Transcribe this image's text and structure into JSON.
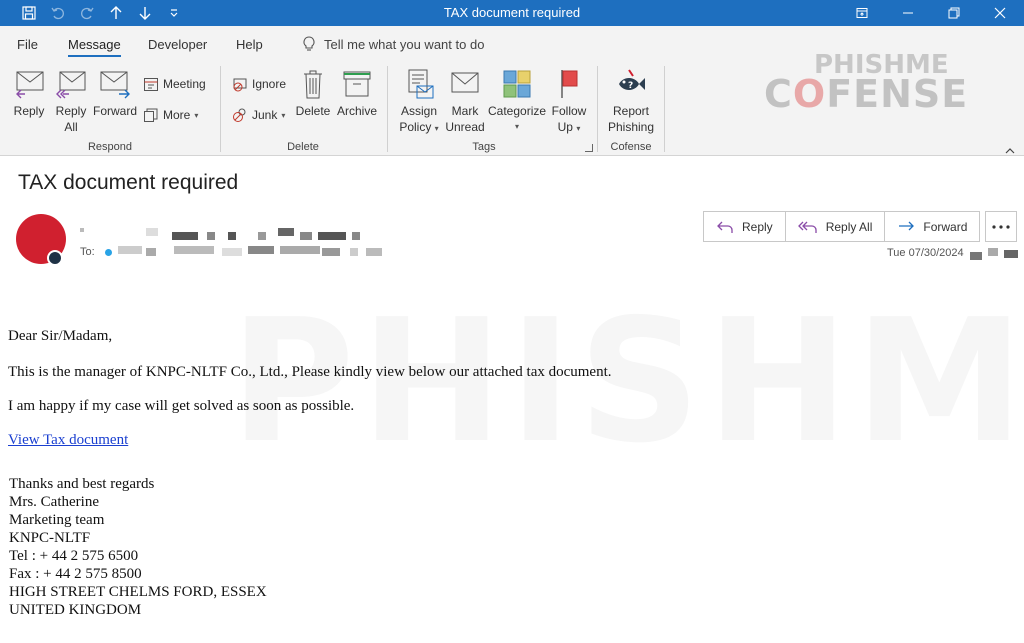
{
  "window": {
    "title": "TAX document required"
  },
  "menu": {
    "tabs": [
      "File",
      "Message",
      "Developer",
      "Help"
    ],
    "tell_me": "Tell me what you want to do"
  },
  "ribbon": {
    "respond": {
      "label": "Respond",
      "reply": "Reply",
      "reply_all_1": "Reply",
      "reply_all_2": "All",
      "forward": "Forward",
      "meeting": "Meeting",
      "more": "More"
    },
    "delete": {
      "label": "Delete",
      "ignore": "Ignore",
      "junk": "Junk",
      "delete": "Delete",
      "archive": "Archive"
    },
    "tags": {
      "label": "Tags",
      "assign_1": "Assign",
      "assign_2": "Policy",
      "mark_1": "Mark",
      "mark_2": "Unread",
      "categorize": "Categorize",
      "follow_1": "Follow",
      "follow_2": "Up"
    },
    "cofense": {
      "label": "Cofense",
      "report_1": "Report",
      "report_2": "Phishing"
    },
    "brand_top": "PHISHME",
    "brand_main_a": "C",
    "brand_main_o": "O",
    "brand_main_b": "FENSE"
  },
  "message": {
    "subject": "TAX document required",
    "to_label": "To:",
    "date": "Tue 07/30/2024",
    "actions": {
      "reply": "Reply",
      "reply_all": "Reply All",
      "forward": "Forward"
    },
    "body": {
      "greeting": "Dear Sir/Madam,",
      "line1": "This is the manager of KNPC-NLTF  Co., Ltd., Please kindly view below our attached tax document.",
      "line2": "I am happy if my case will get solved as soon as possible.",
      "link": "View Tax document",
      "signature": [
        "Thanks and best regards",
        "Mrs. Catherine",
        "Marketing team",
        "KNPC-NLTF",
        "Tel : + 44 2 575 6500",
        "Fax : + 44 2 575 8500",
        "HIGH STREET CHELMS FORD, ESSEX",
        "UNITED KINGDOM"
      ]
    }
  },
  "colors": {
    "titlebar": "#1e6fbf",
    "avatar": "#d0202f",
    "link": "#1a3fd0"
  }
}
